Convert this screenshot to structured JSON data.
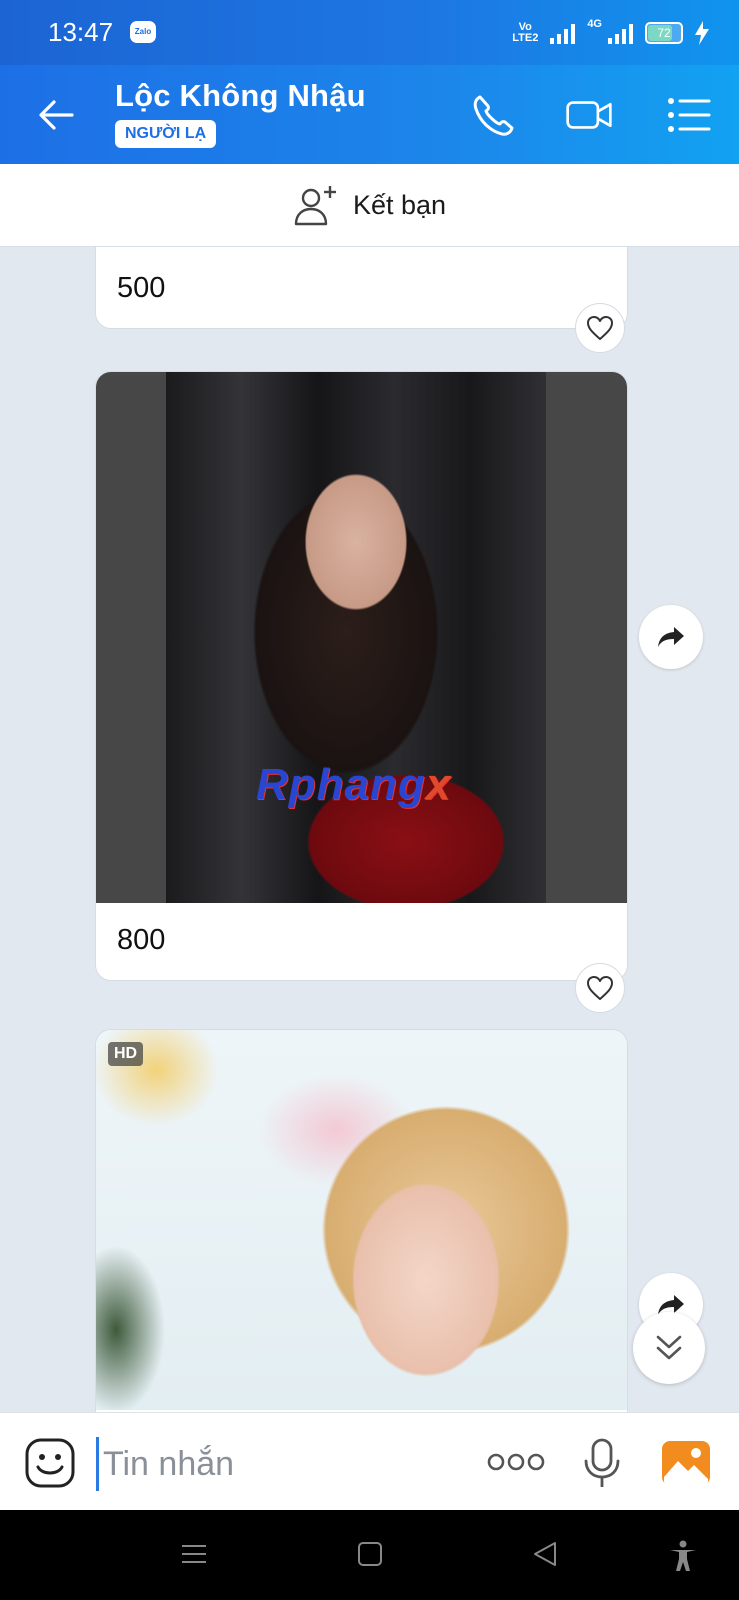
{
  "status_bar": {
    "time": "13:47",
    "app_badge": "Zalo",
    "volte_top": "Vo",
    "volte_bottom": "LTE2",
    "network": "4G",
    "battery": "72"
  },
  "header": {
    "contact_name": "Lộc Không Nhậu",
    "badge": "NGƯỜI LẠ",
    "icons": [
      "back-arrow-icon",
      "phone-icon",
      "video-camera-icon",
      "menu-list-icon"
    ]
  },
  "add_friend": {
    "label": "Kết bạn"
  },
  "messages": [
    {
      "type": "text",
      "text": "500"
    },
    {
      "type": "photo_with_caption",
      "watermark_main": "Rphang",
      "watermark_accent": "x",
      "caption": "800"
    },
    {
      "type": "photo",
      "badge": "HD"
    }
  ],
  "input_bar": {
    "placeholder": "Tin nhắn",
    "icons": [
      "emoji-icon",
      "more-dots-icon",
      "microphone-icon",
      "image-icon"
    ]
  },
  "colors": {
    "header_blue": "#1d78e3",
    "accent": "#2a7ae4",
    "chat_bg": "#e2e8ef"
  }
}
